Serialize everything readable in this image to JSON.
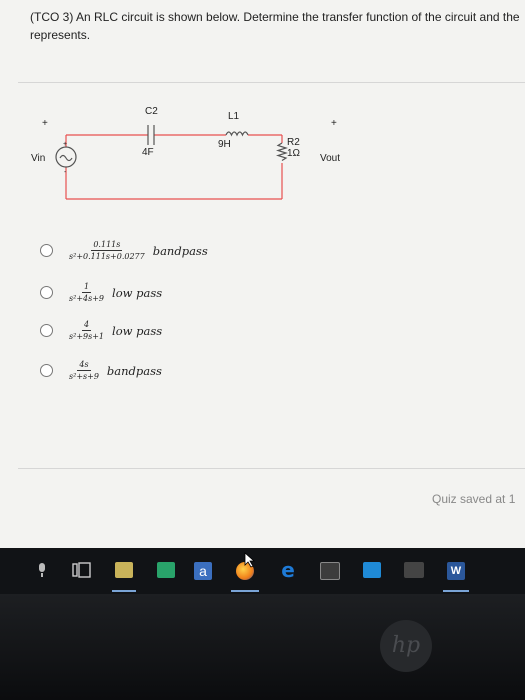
{
  "question": {
    "text": "(TCO 3) An RLC circuit is shown below. Determine the transfer function of the circuit and the",
    "text2": "represents."
  },
  "circuit": {
    "plus_left": "+",
    "plus_right": "+",
    "vin": "Vin",
    "vout": "Vout",
    "c_name": "C2",
    "c_value": "4F",
    "l_name": "L1",
    "l_value": "9H",
    "r_name": "R2",
    "r_value": "1Ω",
    "src_plus": "+",
    "src_minus": "-"
  },
  "options": [
    {
      "num": "0.111s",
      "den": "s²+0.111s+0.0277",
      "label": "bandpass"
    },
    {
      "num": "1",
      "den": "s²+4s+9",
      "label": "low pass"
    },
    {
      "num": "4",
      "den": "s²+9s+1",
      "label": "low pass"
    },
    {
      "num": "4s",
      "den": "s²+s+9",
      "label": "bandpass"
    }
  ],
  "footer": {
    "quiz_saved": "Quiz saved at 1"
  },
  "taskbar": {
    "mail_letter": "a",
    "word_letter": "W"
  },
  "bezel": {
    "logo": "hp"
  },
  "colors": {
    "wire": "#e85050",
    "taskbar": "#111316",
    "edge_blue": "#1e7ad6",
    "mail_blue": "#2a6ebb"
  }
}
